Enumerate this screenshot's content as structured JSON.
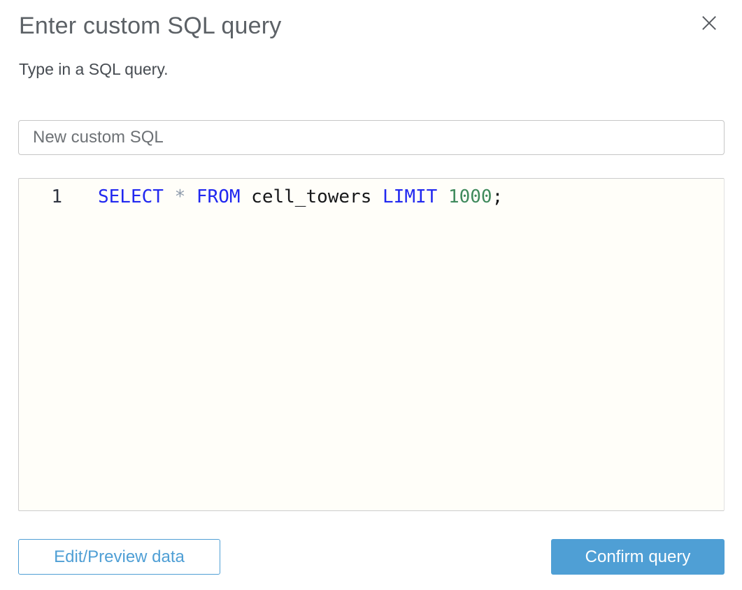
{
  "colors": {
    "accent_blue": "#4f9fd5",
    "keyword_blue": "#2128f0",
    "number_green": "#3f8a5c",
    "operator_gray": "#8e9bab",
    "editor_background": "#fffef9",
    "title_gray": "#5c6166"
  },
  "icons": {
    "close": "×"
  },
  "dialog": {
    "title": "Enter custom SQL query",
    "subtitle": "Type in a SQL query."
  },
  "name_input": {
    "value": "New custom SQL"
  },
  "editor": {
    "line_number": "1",
    "code_text": "SELECT * FROM cell_towers LIMIT 1000;",
    "tokens": [
      {
        "text": "SELECT",
        "type": "keyword"
      },
      {
        "text": " ",
        "type": "plain"
      },
      {
        "text": "*",
        "type": "operator"
      },
      {
        "text": " ",
        "type": "plain"
      },
      {
        "text": "FROM",
        "type": "keyword"
      },
      {
        "text": " ",
        "type": "plain"
      },
      {
        "text": "cell_towers",
        "type": "identifier"
      },
      {
        "text": " ",
        "type": "plain"
      },
      {
        "text": "LIMIT",
        "type": "keyword"
      },
      {
        "text": " ",
        "type": "plain"
      },
      {
        "text": "1000",
        "type": "number"
      },
      {
        "text": ";",
        "type": "plain"
      }
    ]
  },
  "footer": {
    "edit_preview_button": "Edit/Preview data",
    "confirm_button": "Confirm query"
  }
}
